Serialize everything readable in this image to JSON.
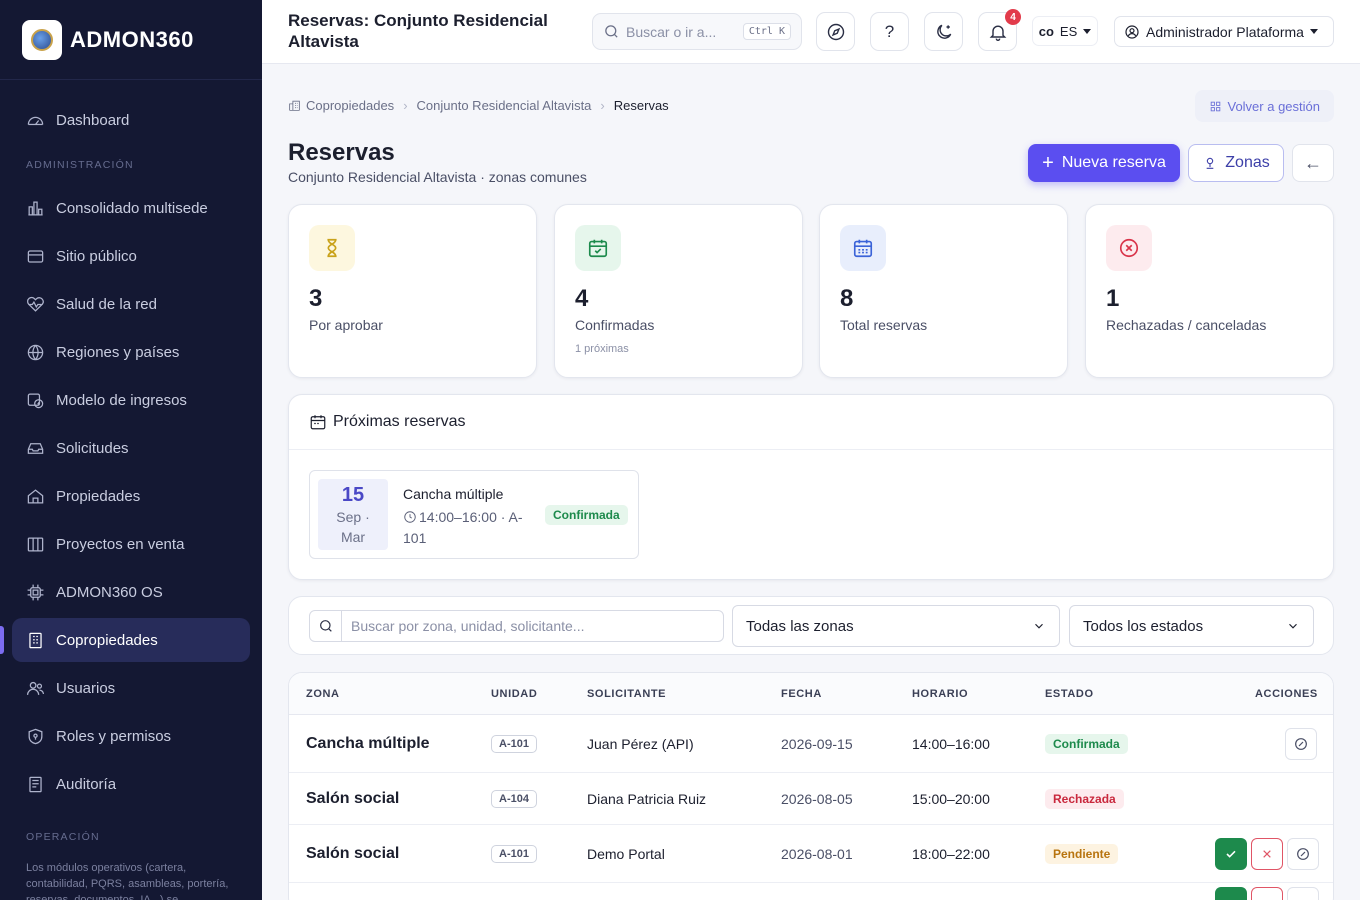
{
  "brand": {
    "name": "ADMON360"
  },
  "sidebar": {
    "items_top": [
      {
        "label": "Dashboard",
        "icon": "dashboard-icon"
      }
    ],
    "section_admin": "ADMINISTRACIÓN",
    "items_admin": [
      {
        "label": "Consolidado multisede",
        "icon": "chart-icon"
      },
      {
        "label": "Sitio público",
        "icon": "window-icon"
      },
      {
        "label": "Salud de la red",
        "icon": "pulse-icon"
      },
      {
        "label": "Regiones y países",
        "icon": "globe-icon"
      },
      {
        "label": "Modelo de ingresos",
        "icon": "revenue-icon"
      },
      {
        "label": "Solicitudes",
        "icon": "inbox-icon"
      },
      {
        "label": "Propiedades",
        "icon": "house-icon"
      },
      {
        "label": "Proyectos en venta",
        "icon": "book-icon"
      },
      {
        "label": "ADMON360 OS",
        "icon": "chip-icon"
      },
      {
        "label": "Copropiedades",
        "icon": "building-icon",
        "active": true
      },
      {
        "label": "Usuarios",
        "icon": "users-icon"
      },
      {
        "label": "Roles y permisos",
        "icon": "shield-icon"
      },
      {
        "label": "Auditoría",
        "icon": "audit-icon"
      }
    ],
    "section_ops": "OPERACIÓN",
    "ops_note": "Los módulos operativos (cartera, contabilidad, PQRS, asambleas, portería, reservas, documentos, IA...) se"
  },
  "topbar": {
    "title": "Reservas: Conjunto Residencial Altavista",
    "search_placeholder": "Buscar o ir a...",
    "search_shortcut": "Ctrl K",
    "help_label": "?",
    "notifications_count": "4",
    "country_code": "co",
    "language": "ES",
    "user_name": "Administrador Plataforma"
  },
  "breadcrumb": {
    "items": [
      "Copropiedades",
      "Conjunto Residencial Altavista",
      "Reservas"
    ]
  },
  "header": {
    "back_to_management": "Volver a gestión",
    "title": "Reservas",
    "subtitle": "Conjunto Residencial Altavista · zonas comunes",
    "new_reservation": "Nueva reserva",
    "zones": "Zonas",
    "back_arrow": "←"
  },
  "stats": [
    {
      "value": "3",
      "label": "Por aprobar",
      "sub": "",
      "icon": "hourglass-icon",
      "color": "#c9a21a",
      "bg": "#fdf7df"
    },
    {
      "value": "4",
      "label": "Confirmadas",
      "sub": "1 próximas",
      "icon": "calendar-check-icon",
      "color": "#1d8a4c",
      "bg": "#e6f6ec"
    },
    {
      "value": "8",
      "label": "Total reservas",
      "sub": "",
      "icon": "calendar-grid-icon",
      "color": "#3b63d8",
      "bg": "#e8eefc"
    },
    {
      "value": "1",
      "label": "Rechazadas / canceladas",
      "sub": "",
      "icon": "x-circle-icon",
      "color": "#d9344a",
      "bg": "#fdebee"
    }
  ],
  "upcoming": {
    "title": "Próximas reservas",
    "items": [
      {
        "day": "15",
        "month": "Sep ·",
        "weekday": "Mar",
        "zone": "Cancha múltiple",
        "time": "14:00–16:00 · A-101",
        "status": "Confirmada"
      }
    ]
  },
  "filters": {
    "search_placeholder": "Buscar por zona, unidad, solicitante...",
    "zones_value": "Todas las zonas",
    "status_value": "Todos los estados"
  },
  "table": {
    "headers": [
      "ZONA",
      "UNIDAD",
      "SOLICITANTE",
      "FECHA",
      "HORARIO",
      "ESTADO",
      "ACCIONES"
    ],
    "rows": [
      {
        "zone": "Cancha múltiple",
        "unit": "A-101",
        "requester": "Juan Pérez (API)",
        "date": "2026-09-15",
        "time": "14:00–16:00",
        "status": "Confirmada",
        "status_kind": "ok"
      },
      {
        "zone": "Salón social",
        "unit": "A-104",
        "requester": "Diana Patricia Ruiz",
        "date": "2026-08-05",
        "time": "15:00–20:00",
        "status": "Rechazada",
        "status_kind": "no"
      },
      {
        "zone": "Salón social",
        "unit": "A-101",
        "requester": "Demo Portal",
        "date": "2026-08-01",
        "time": "18:00–22:00",
        "status": "Pendiente",
        "status_kind": "pend"
      }
    ]
  }
}
